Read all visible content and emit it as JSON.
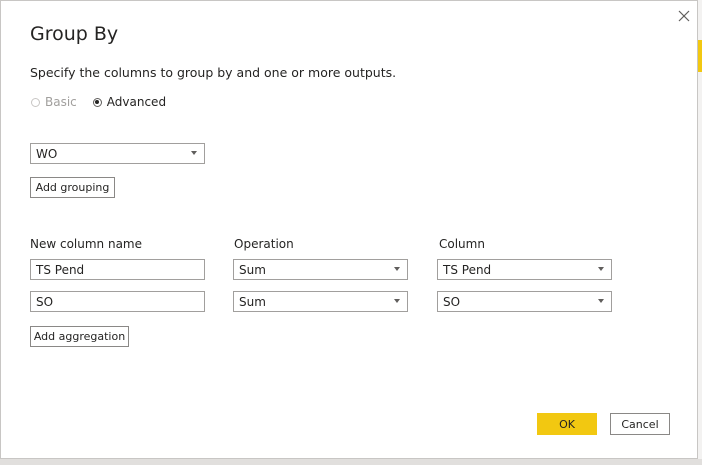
{
  "dialog": {
    "title": "Group By",
    "subtitle": "Specify the columns to group by and one or more outputs.",
    "close_icon": "close-icon"
  },
  "mode": {
    "basic_label": "Basic",
    "advanced_label": "Advanced",
    "selected": "Advanced"
  },
  "grouping": {
    "columns": [
      "WO"
    ],
    "add_label": "Add grouping"
  },
  "aggregations": {
    "headers": {
      "new_column_name": "New column name",
      "operation": "Operation",
      "column": "Column"
    },
    "rows": [
      {
        "name": "TS Pend",
        "operation": "Sum",
        "column": "TS Pend"
      },
      {
        "name": "SO",
        "operation": "Sum",
        "column": "SO"
      }
    ],
    "add_label": "Add aggregation"
  },
  "footer": {
    "ok_label": "OK",
    "cancel_label": "Cancel"
  },
  "colors": {
    "accent": "#f2c811",
    "border": "#a19f9d",
    "text": "#252423"
  }
}
